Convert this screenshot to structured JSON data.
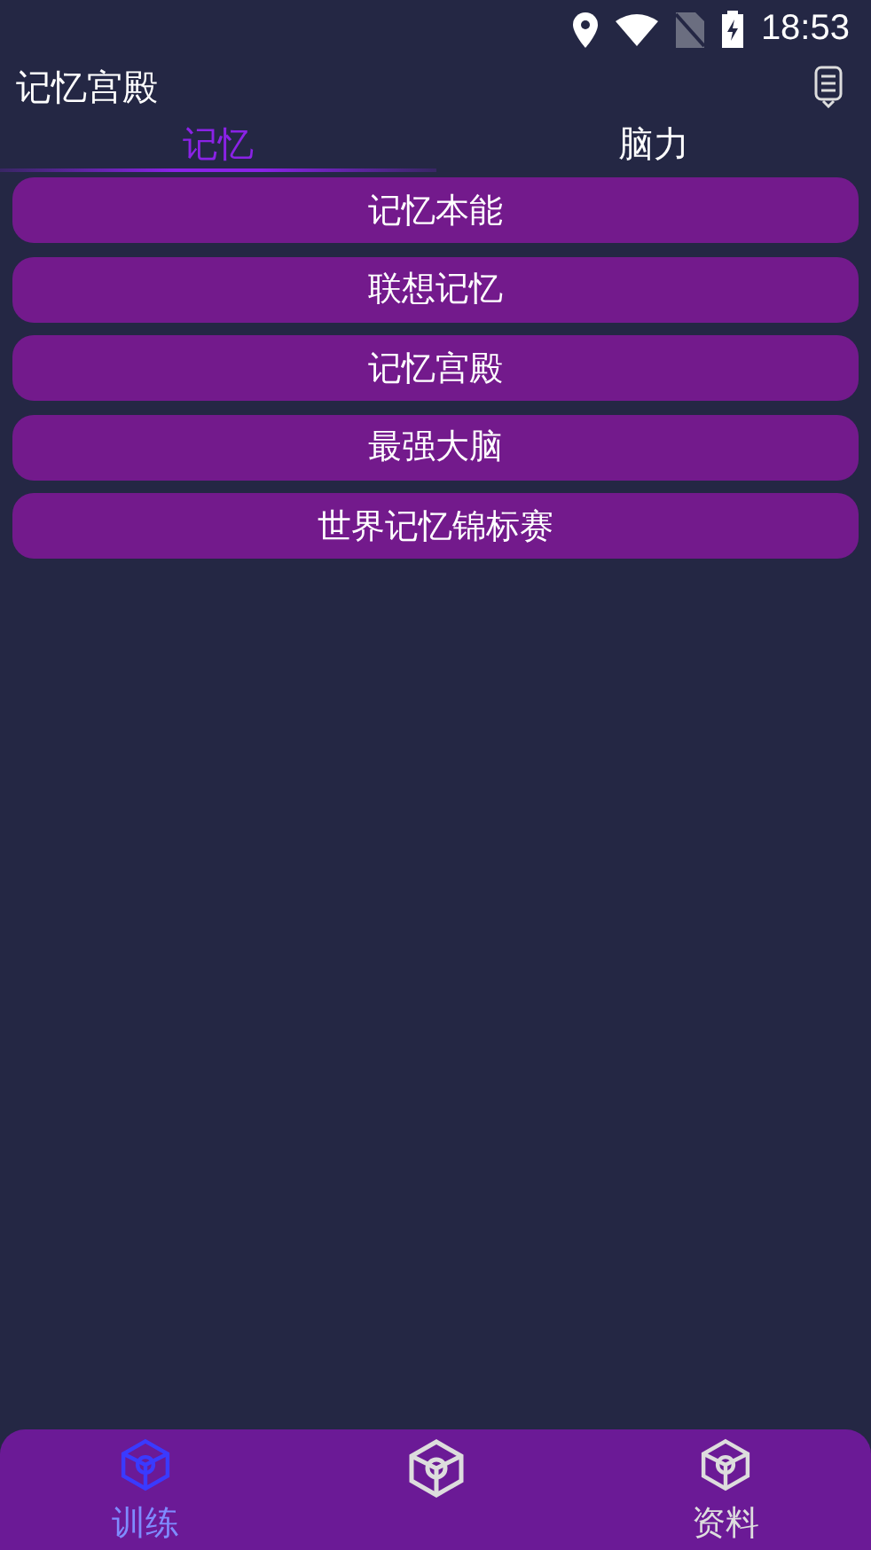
{
  "status_bar": {
    "time": "18:53"
  },
  "app_bar": {
    "title": "记忆宫殿"
  },
  "tabs": [
    {
      "label": "记忆",
      "selected": true
    },
    {
      "label": "脑力",
      "selected": false
    }
  ],
  "categories": [
    "记忆本能",
    "联想记忆",
    "记忆宫殿",
    "最强大脑",
    "世界记忆锦标赛"
  ],
  "bottom_nav": [
    {
      "label": "训练",
      "selected": true
    },
    {
      "selected": false
    },
    {
      "label": "资料",
      "selected": false
    }
  ]
}
